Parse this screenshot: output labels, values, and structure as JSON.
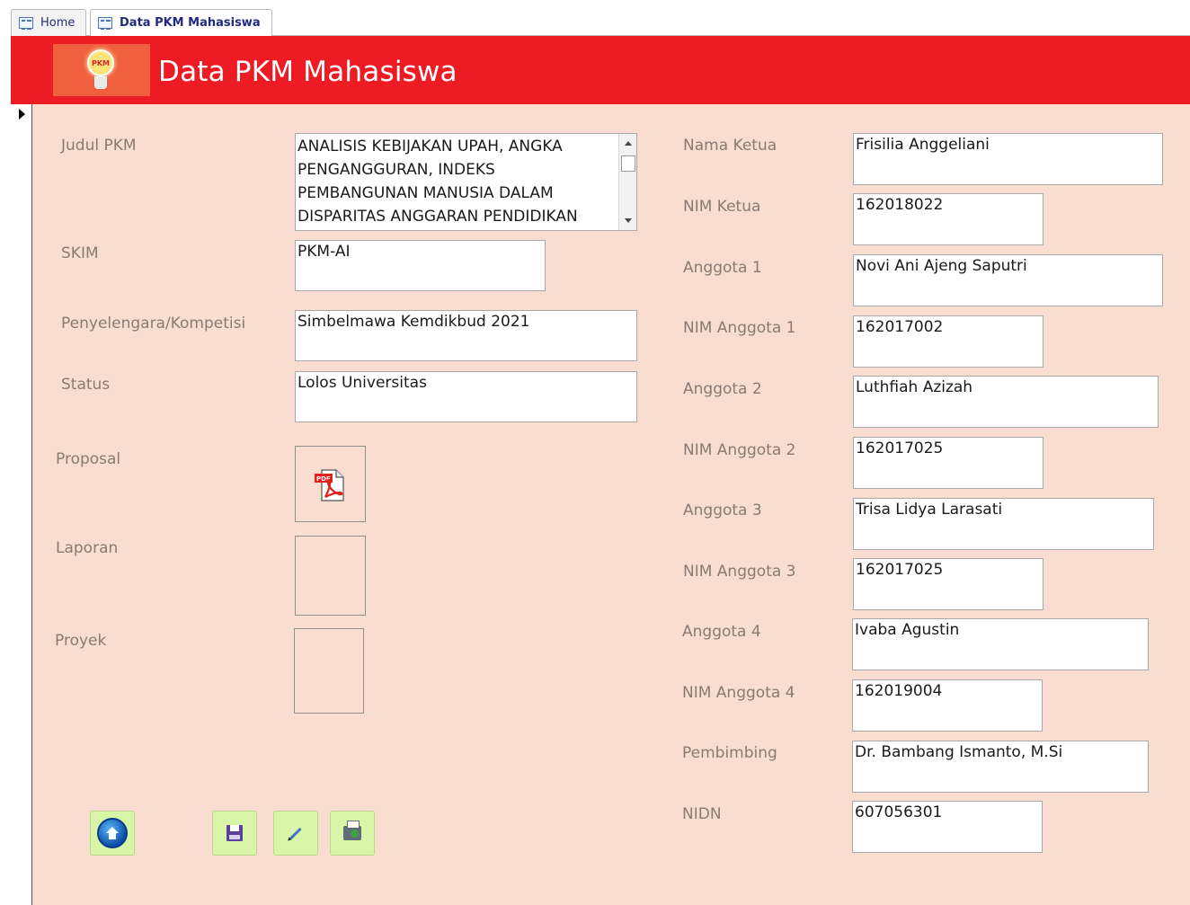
{
  "tabs": [
    {
      "label": "Home",
      "active": false,
      "icon": "form-icon"
    },
    {
      "label": "Data PKM Mahasiswa",
      "active": true,
      "icon": "form-icon"
    }
  ],
  "header": {
    "title": "Data PKM Mahasiswa",
    "logo_text": "PKM",
    "color": "#ed1c24"
  },
  "form": {
    "background": "#f9ddd0",
    "left": [
      {
        "label": "Judul PKM",
        "value": "ANALISIS KEBIJAKAN UPAH, ANGKA PENGANGGURAN, INDEKS PEMBANGUNAN MANUSIA DALAM DISPARITAS ANGGARAN PENDIDIKAN"
      },
      {
        "label": "SKIM",
        "value": "PKM-AI"
      },
      {
        "label": "Penyelengara/Kompetisi",
        "value": "Simbelmawa Kemdikbud 2021"
      },
      {
        "label": "Status",
        "value": "Lolos Universitas"
      }
    ],
    "attachments": [
      {
        "label": "Proposal",
        "icon": "pdf-icon",
        "has_file": true
      },
      {
        "label": "Laporan",
        "icon": "",
        "has_file": false
      },
      {
        "label": "Proyek",
        "icon": "",
        "has_file": false
      }
    ],
    "right": [
      {
        "label": "Nama Ketua",
        "value": "Frisilia Anggeliani"
      },
      {
        "label": "NIM Ketua",
        "value": "162018022"
      },
      {
        "label": "Anggota 1",
        "value": "Novi Ani Ajeng Saputri"
      },
      {
        "label": "NIM Anggota 1",
        "value": "162017002"
      },
      {
        "label": "Anggota 2",
        "value": "Luthfiah Azizah"
      },
      {
        "label": "NIM Anggota 2",
        "value": "162017025"
      },
      {
        "label": "Anggota 3",
        "value": "Trisa Lidya Larasati"
      },
      {
        "label": "NIM Anggota 3",
        "value": "162017025"
      },
      {
        "label": "Anggota 4",
        "value": "Ivaba Agustin"
      },
      {
        "label": "NIM Anggota 4",
        "value": "162019004"
      },
      {
        "label": "Pembimbing",
        "value": "Dr. Bambang Ismanto, M.Si"
      },
      {
        "label": "NIDN",
        "value": "607056301"
      }
    ]
  },
  "buttons": [
    {
      "icon": "home-icon"
    },
    {
      "icon": "save-icon"
    },
    {
      "icon": "edit-icon"
    },
    {
      "icon": "print-icon"
    }
  ]
}
